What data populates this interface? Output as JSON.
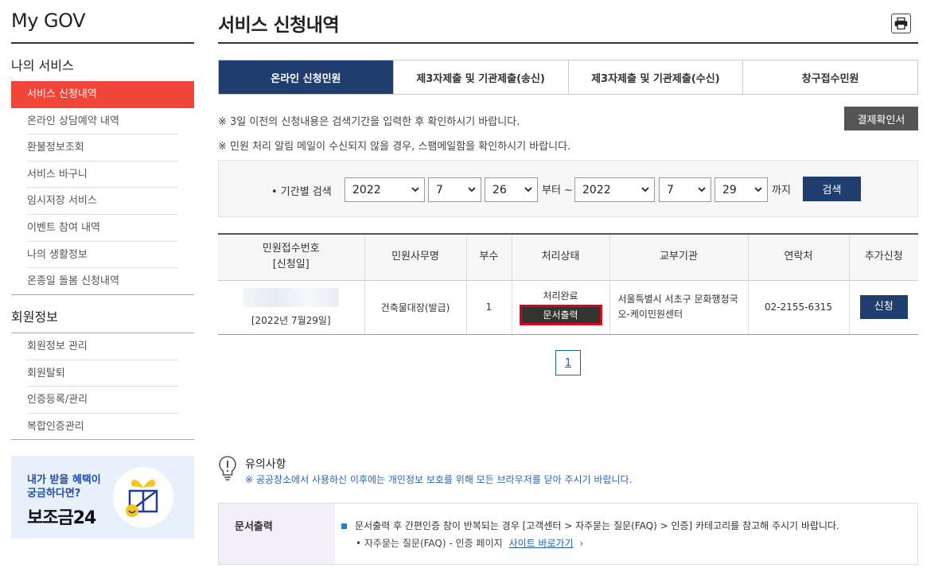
{
  "sidebar": {
    "brand": "My GOV",
    "section1_title": "나의 서비스",
    "section1_items": [
      {
        "label": "서비스 신청내역"
      },
      {
        "label": "온라인 상담예약 내역"
      },
      {
        "label": "환불정보조회"
      },
      {
        "label": "서비스 바구니"
      },
      {
        "label": "임시저장 서비스"
      },
      {
        "label": "이벤트 참여 내역"
      },
      {
        "label": "나의 생활정보"
      },
      {
        "label": "온종일 돌봄 신청내역"
      }
    ],
    "section2_title": "회원정보",
    "section2_items": [
      {
        "label": "회원정보 관리"
      },
      {
        "label": "회원탈퇴"
      },
      {
        "label": "인증등록/관리"
      },
      {
        "label": "복합인증관리"
      }
    ],
    "banner": {
      "line1": "내가 받을 혜택이",
      "line2": "궁금하다면?",
      "brand": "보조금24"
    }
  },
  "main": {
    "title": "서비스 신청내역",
    "print_icon": "printer-icon",
    "tabs": [
      {
        "label": "온라인 신청민원",
        "active": true
      },
      {
        "label": "제3자제출 및 기관제출(송신)"
      },
      {
        "label": "제3자제출 및 기관제출(수신)"
      },
      {
        "label": "창구접수민원"
      }
    ],
    "notice1": "※ 3일 이전의 신청내용은 검색기간을 입력한 후 확인하시기 바랍니다.",
    "notice2": "※ 민원 처리 알림 메일이 수신되지 않을 경우, 스팸메일함을 확인하시기 바랍니다.",
    "receipt_button": "결제확인서",
    "search": {
      "label": "• 기간별 검색",
      "from_year": "2022",
      "from_month": "7",
      "from_day": "26",
      "from_text": "부터 ~",
      "to_year": "2022",
      "to_month": "7",
      "to_day": "29",
      "to_text": "까지",
      "button": "검색"
    },
    "table": {
      "headers": {
        "receipt_no": "민원접수번호",
        "apply_date": "[신청일]",
        "work": "민원사무명",
        "copies": "부수",
        "state": "처리상태",
        "org": "교부기관",
        "contact": "연락처",
        "extra": "추가신청"
      },
      "rows": [
        {
          "date": "[2022년 7월29일]",
          "work": "건축물대장(발급)",
          "copies": "1",
          "state": "처리완료",
          "doc_button": "문서출력",
          "org": "서울특별시 서초구 문화행정국 오-케이민원센터",
          "contact": "02-2155-6315",
          "apply_button": "신청"
        }
      ]
    },
    "pagination": {
      "current": "1"
    },
    "caution": {
      "title": "유의사항",
      "text": "※ 공공장소에서 사용하신 이후에는 개인정보 보호를 위해 모든 브라우저를 닫아 주시기 바랍니다."
    },
    "info": {
      "head": "문서출력",
      "line1": "문서출력 후 간편인증 창이 반복되는 경우 [고객센터 > 자주묻는 질문(FAQ) > 인증] 카테고리를 참고해 주시기 바랍니다.",
      "line2": "• 자주묻는 질문(FAQ) - 인증 페이지",
      "link": "사이트 바로가기"
    }
  }
}
